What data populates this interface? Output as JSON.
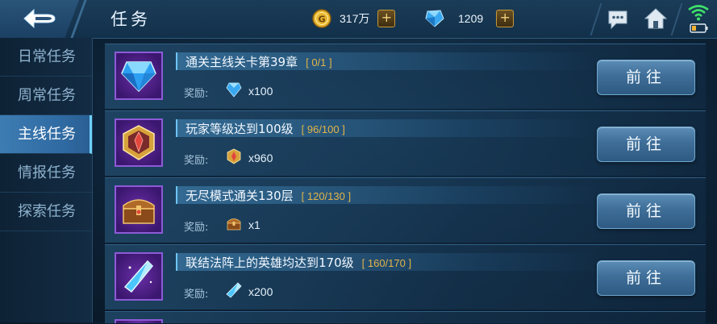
{
  "header": {
    "title": "任务",
    "gold_amount": "317万",
    "diamond_amount": "1209",
    "plus_label": "+"
  },
  "sidebar": {
    "items": [
      {
        "label": "日常任务",
        "active": false
      },
      {
        "label": "周常任务",
        "active": false
      },
      {
        "label": "主线任务",
        "active": true
      },
      {
        "label": "情报任务",
        "active": false
      },
      {
        "label": "探索任务",
        "active": false
      }
    ]
  },
  "tasks": [
    {
      "title": "通关主线关卡第39章",
      "progress": "[ 0/1 ]",
      "reward_label": "奖励:",
      "reward_amount": "x100",
      "icon": "blue-diamond-icon",
      "reward_icon": "diamond-icon",
      "button": "前往"
    },
    {
      "title": "玩家等级达到100级",
      "progress": "[ 96/100 ]",
      "reward_label": "奖励:",
      "reward_amount": "x960",
      "icon": "gold-crest-icon",
      "reward_icon": "crest-icon",
      "button": "前往"
    },
    {
      "title": "无尽模式通关130层",
      "progress": "[ 120/130 ]",
      "reward_label": "奖励:",
      "reward_amount": "x1",
      "icon": "treasure-chest-icon",
      "reward_icon": "chest-icon",
      "button": "前往"
    },
    {
      "title": "联结法阵上的英雄均达到170级",
      "progress": "[ 160/170 ]",
      "reward_label": "奖励:",
      "reward_amount": "x200",
      "icon": "crystal-shard-icon",
      "reward_icon": "shard-icon",
      "button": "前往"
    }
  ],
  "colors": {
    "accent_blue": "#3d7cb2",
    "progress_gold": "#e3b44a",
    "icon_frame_purple": "#8d5bd6"
  }
}
